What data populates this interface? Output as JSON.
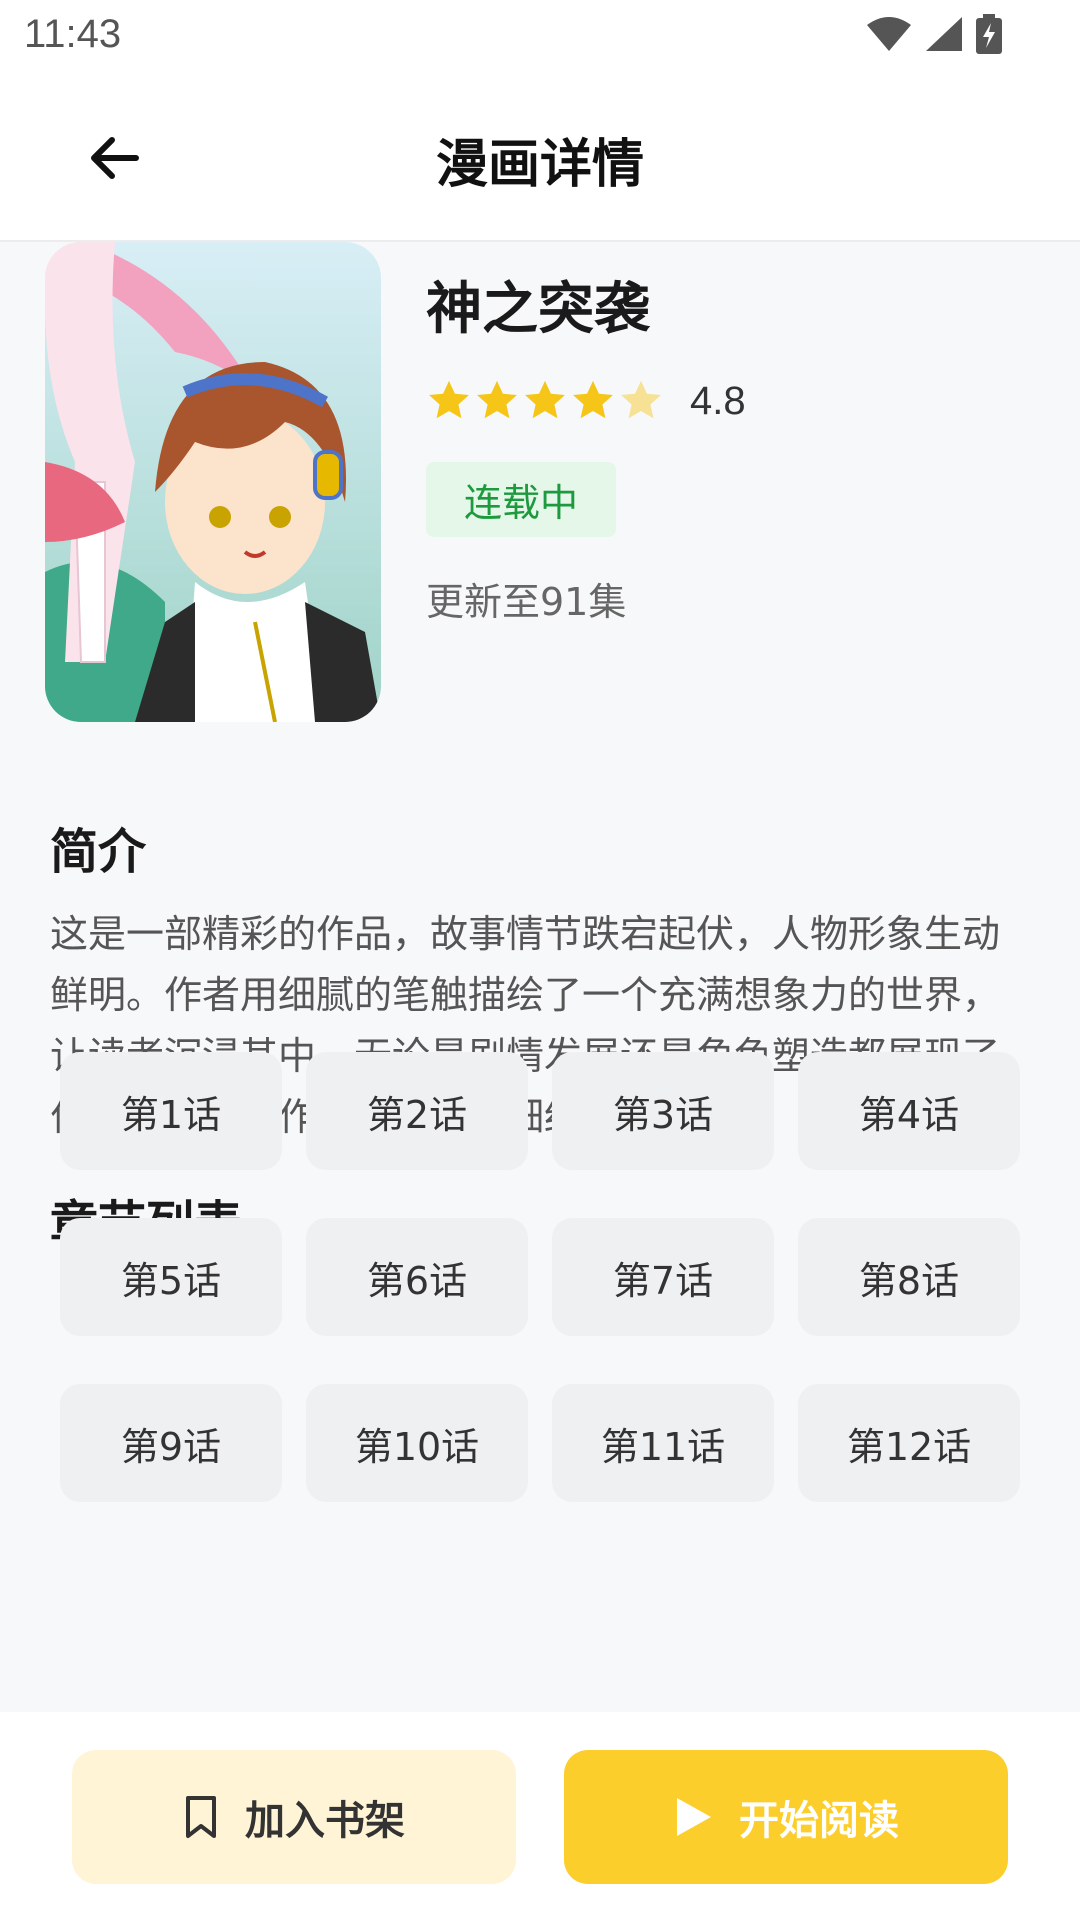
{
  "status_bar": {
    "time": "11:43",
    "icons": [
      "wifi-icon",
      "signal-icon",
      "battery-charging-icon"
    ]
  },
  "app_bar": {
    "title": "漫画详情",
    "back_icon": "arrow-left-icon"
  },
  "comic": {
    "title": "神之突袭",
    "rating": "4.8",
    "rating_value": 4.8,
    "rating_max": 5,
    "status": "连载中",
    "update": "更新至91集",
    "cover_icon": "comic-cover-image"
  },
  "intro": {
    "heading": "简介",
    "text": "这是一部精彩的作品，故事情节跌宕起伏，人物形象生动鲜明。作者用细腻的笔触描绘了一个充满想象力的世界，让读者沉浸其中。无论是剧情发展还是角色塑造都展现了作者深厚的创作功底，值得细细品味。"
  },
  "chapters": {
    "heading": "章节列表",
    "items": [
      "第1话",
      "第2话",
      "第3话",
      "第4话",
      "第5话",
      "第6话",
      "第7话",
      "第8话",
      "第9话",
      "第10话",
      "第11话",
      "第12话"
    ]
  },
  "actions": {
    "shelf_label": "加入书架",
    "read_label": "开始阅读",
    "shelf_icon": "bookmark-icon",
    "read_icon": "play-icon"
  },
  "colors": {
    "accent": "#FCCE2B",
    "accent_light": "#FFF4D6",
    "star": "#F5C518",
    "status_green": "#1E9A3E",
    "status_green_bg": "#E5F7E9",
    "background": "#F7F8FA"
  }
}
